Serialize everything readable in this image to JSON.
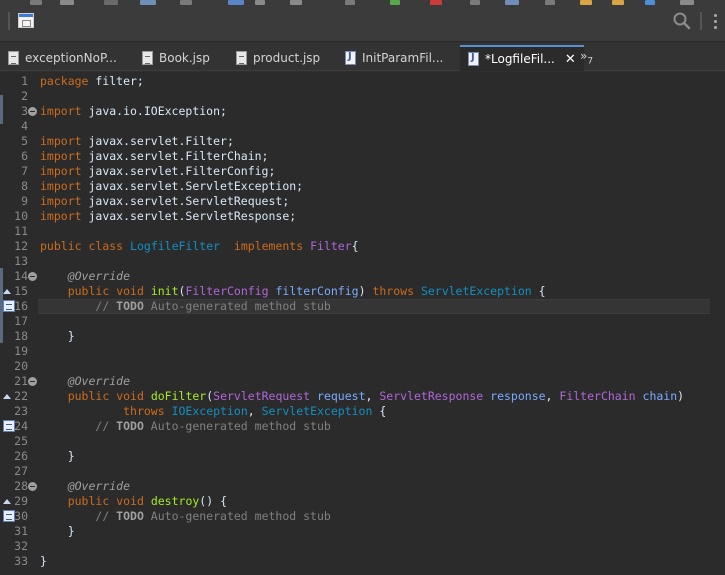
{
  "colors": {
    "background": "#2b2b2b",
    "keyword": "#cc6c1d",
    "annotation": "#a0a0a0",
    "class_type": "#1290c3",
    "interface_type": "#b166da",
    "method_declaration": "#a7ec21",
    "parameter": "#79abff",
    "comment": "#808080",
    "plain": "#d9e8f7"
  },
  "toolbar": {
    "search_icon": "search-icon",
    "new_window_icon": "new-window-icon"
  },
  "tabs": [
    {
      "label": "exceptionNoP...",
      "icon": "jsp-file-icon",
      "active": false
    },
    {
      "label": "Book.jsp",
      "icon": "jsp-file-icon",
      "active": false
    },
    {
      "label": "product.jsp",
      "icon": "jsp-file-icon",
      "active": false
    },
    {
      "label": "InitParamFil...",
      "icon": "java-file-icon",
      "active": false
    },
    {
      "label": "*LogfileFil...",
      "icon": "java-file-icon",
      "active": true,
      "close": "✕"
    }
  ],
  "tab_overflow": {
    "label": "»",
    "count": "7"
  },
  "editor": {
    "current_line": 16,
    "lines": [
      {
        "n": "1",
        "tokens": [
          [
            "kw",
            "package"
          ],
          [
            "p",
            " filter;"
          ]
        ]
      },
      {
        "n": "2",
        "tokens": []
      },
      {
        "n": "3",
        "fold": true,
        "tokens": [
          [
            "kw",
            "import"
          ],
          [
            "p",
            " java.io.IOException;"
          ]
        ]
      },
      {
        "n": "4",
        "tokens": []
      },
      {
        "n": "5",
        "tokens": [
          [
            "kw",
            "import"
          ],
          [
            "p",
            " javax.servlet.Filter;"
          ]
        ]
      },
      {
        "n": "6",
        "tokens": [
          [
            "kw",
            "import"
          ],
          [
            "p",
            " javax.servlet.FilterChain;"
          ]
        ]
      },
      {
        "n": "7",
        "tokens": [
          [
            "kw",
            "import"
          ],
          [
            "p",
            " javax.servlet.FilterConfig;"
          ]
        ]
      },
      {
        "n": "8",
        "tokens": [
          [
            "kw",
            "import"
          ],
          [
            "p",
            " javax.servlet.ServletException;"
          ]
        ]
      },
      {
        "n": "9",
        "tokens": [
          [
            "kw",
            "import"
          ],
          [
            "p",
            " javax.servlet.ServletRequest;"
          ]
        ]
      },
      {
        "n": "10",
        "tokens": [
          [
            "kw",
            "import"
          ],
          [
            "p",
            " javax.servlet.ServletResponse;"
          ]
        ]
      },
      {
        "n": "11",
        "tokens": []
      },
      {
        "n": "12",
        "tokens": [
          [
            "kw",
            "public"
          ],
          [
            "p",
            " "
          ],
          [
            "kw",
            "class"
          ],
          [
            "p",
            " "
          ],
          [
            "cls",
            "LogfileFilter"
          ],
          [
            "p",
            "  "
          ],
          [
            "kw",
            "implements"
          ],
          [
            "p",
            " "
          ],
          [
            "iface",
            "Filter"
          ],
          [
            "p",
            "{"
          ]
        ]
      },
      {
        "n": "13",
        "tokens": []
      },
      {
        "n": "14",
        "fold": true,
        "tokens": [
          [
            "p",
            "    "
          ],
          [
            "an",
            "@Override"
          ]
        ]
      },
      {
        "n": "15",
        "marker": "override",
        "tokens": [
          [
            "p",
            "    "
          ],
          [
            "kw",
            "public"
          ],
          [
            "p",
            " "
          ],
          [
            "kw",
            "void"
          ],
          [
            "p",
            " "
          ],
          [
            "mth",
            "init"
          ],
          [
            "p",
            "("
          ],
          [
            "iface",
            "FilterConfig"
          ],
          [
            "p",
            " "
          ],
          [
            "prm",
            "filterConfig"
          ],
          [
            "p",
            ") "
          ],
          [
            "kw",
            "throws"
          ],
          [
            "p",
            " "
          ],
          [
            "cls",
            "ServletException"
          ],
          [
            "p",
            " {"
          ]
        ]
      },
      {
        "n": "16",
        "marker": "task",
        "tokens": [
          [
            "p",
            "        "
          ],
          [
            "cm",
            "// "
          ],
          [
            "todo",
            "TODO"
          ],
          [
            "cm",
            " Auto-generated method stub"
          ]
        ]
      },
      {
        "n": "17",
        "tokens": []
      },
      {
        "n": "18",
        "tokens": [
          [
            "p",
            "    }"
          ]
        ]
      },
      {
        "n": "19",
        "tokens": []
      },
      {
        "n": "20",
        "tokens": []
      },
      {
        "n": "21",
        "fold": true,
        "tokens": [
          [
            "p",
            "    "
          ],
          [
            "an",
            "@Override"
          ]
        ]
      },
      {
        "n": "22",
        "marker": "override",
        "tokens": [
          [
            "p",
            "    "
          ],
          [
            "kw",
            "public"
          ],
          [
            "p",
            " "
          ],
          [
            "kw",
            "void"
          ],
          [
            "p",
            " "
          ],
          [
            "mth",
            "doFilter"
          ],
          [
            "p",
            "("
          ],
          [
            "iface",
            "ServletRequest"
          ],
          [
            "p",
            " "
          ],
          [
            "prm",
            "request"
          ],
          [
            "p",
            ", "
          ],
          [
            "iface",
            "ServletResponse"
          ],
          [
            "p",
            " "
          ],
          [
            "prm",
            "response"
          ],
          [
            "p",
            ", "
          ],
          [
            "iface",
            "FilterChain"
          ],
          [
            "p",
            " "
          ],
          [
            "prm",
            "chain"
          ],
          [
            "p",
            ")"
          ]
        ]
      },
      {
        "n": "23",
        "tokens": [
          [
            "p",
            "            "
          ],
          [
            "kw",
            "throws"
          ],
          [
            "p",
            " "
          ],
          [
            "cls",
            "IOException"
          ],
          [
            "p",
            ", "
          ],
          [
            "cls",
            "ServletException"
          ],
          [
            "p",
            " {"
          ]
        ]
      },
      {
        "n": "24",
        "marker": "task",
        "tokens": [
          [
            "p",
            "        "
          ],
          [
            "cm",
            "// "
          ],
          [
            "todo",
            "TODO"
          ],
          [
            "cm",
            " Auto-generated method stub"
          ]
        ]
      },
      {
        "n": "25",
        "tokens": []
      },
      {
        "n": "26",
        "tokens": [
          [
            "p",
            "    }"
          ]
        ]
      },
      {
        "n": "27",
        "tokens": []
      },
      {
        "n": "28",
        "fold": true,
        "tokens": [
          [
            "p",
            "    "
          ],
          [
            "an",
            "@Override"
          ]
        ]
      },
      {
        "n": "29",
        "marker": "override",
        "tokens": [
          [
            "p",
            "    "
          ],
          [
            "kw",
            "public"
          ],
          [
            "p",
            " "
          ],
          [
            "kw",
            "void"
          ],
          [
            "p",
            " "
          ],
          [
            "mth",
            "destroy"
          ],
          [
            "p",
            "() {"
          ]
        ]
      },
      {
        "n": "30",
        "marker": "task",
        "tokens": [
          [
            "p",
            "        "
          ],
          [
            "cm",
            "// "
          ],
          [
            "todo",
            "TODO"
          ],
          [
            "cm",
            " Auto-generated method stub"
          ]
        ]
      },
      {
        "n": "31",
        "tokens": [
          [
            "p",
            "    }"
          ]
        ]
      },
      {
        "n": "32",
        "tokens": []
      },
      {
        "n": "33",
        "tokens": [
          [
            "p",
            "}"
          ]
        ]
      }
    ]
  }
}
